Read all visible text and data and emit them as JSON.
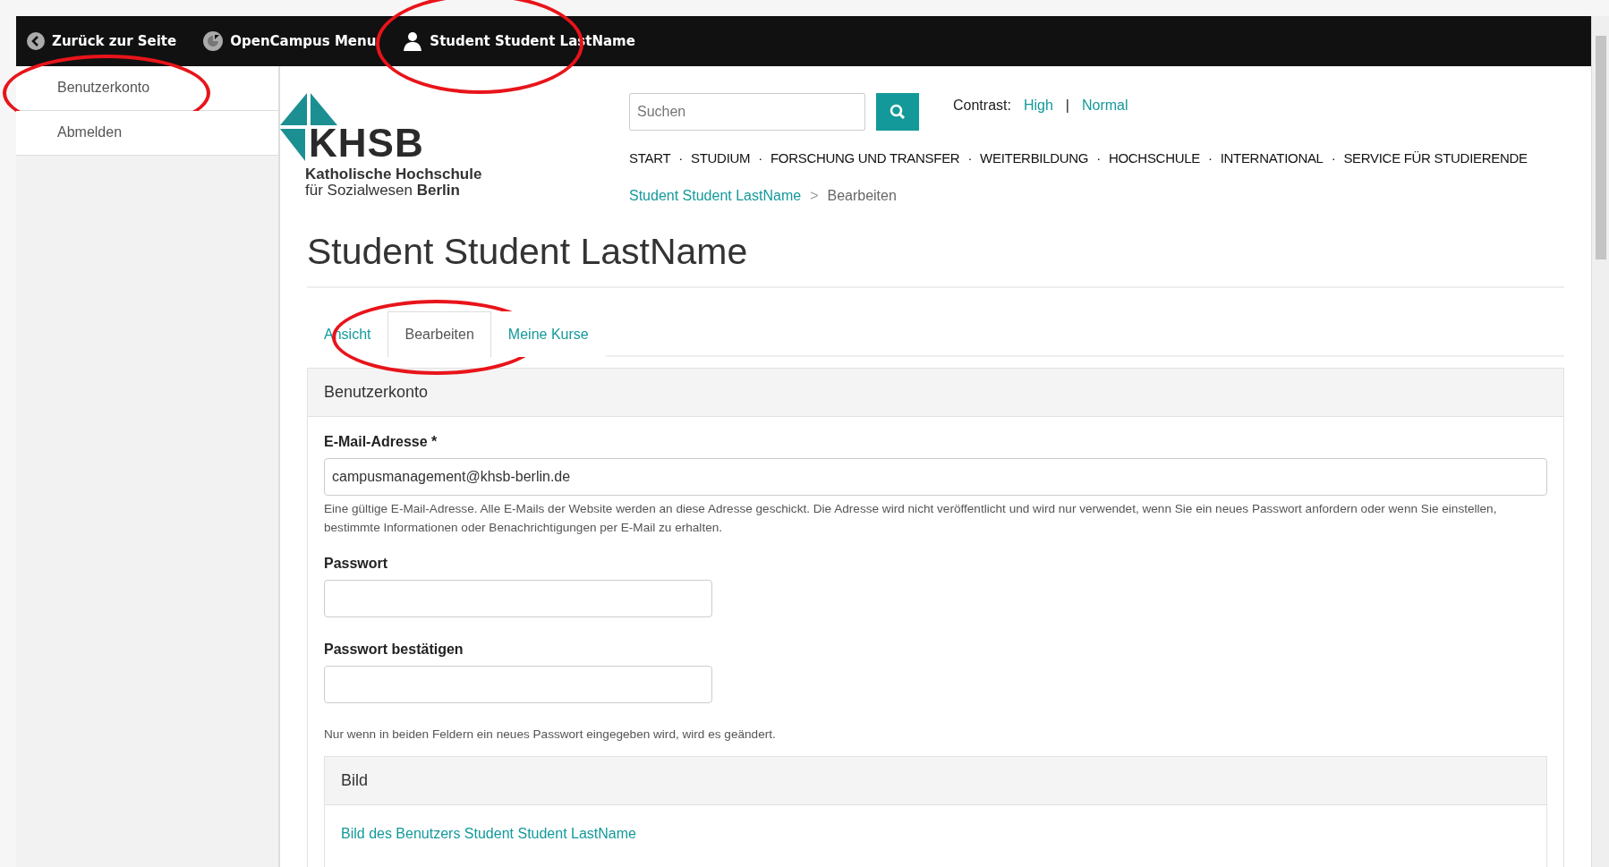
{
  "toolbar": {
    "items": [
      {
        "kind": "back",
        "label": "Zurück zur Seite",
        "highlighted": false
      },
      {
        "kind": "menu",
        "label": "OpenCampus Menu",
        "highlighted": false
      },
      {
        "kind": "user",
        "label": "Student Student LastName",
        "highlighted": true
      }
    ]
  },
  "sidebar": {
    "items": [
      {
        "label": "Benutzerkonto",
        "highlighted": true
      },
      {
        "label": "Abmelden",
        "highlighted": false
      }
    ]
  },
  "logo": {
    "wordmark": "KHSB",
    "line_1": "Katholische Hochschule",
    "line_2": "für Sozialwesen **Berlin**"
  },
  "search": {
    "placeholder": "Suchen"
  },
  "contrast": {
    "label": "Contrast:",
    "separator": "|",
    "options": [
      {
        "label": "High"
      },
      {
        "label": "Normal"
      }
    ]
  },
  "main_nav": {
    "separator": "·",
    "items": [
      "START",
      "STUDIUM",
      "FORSCHUNG UND TRANSFER",
      "WEITERBILDUNG",
      "HOCHSCHULE",
      "INTERNATIONAL",
      "SERVICE FÜR STUDIERENDE"
    ]
  },
  "breadcrumb": {
    "separator": ">",
    "items": [
      {
        "label": "Student Student LastName",
        "link": true
      },
      {
        "label": "Bearbeiten",
        "link": false
      }
    ]
  },
  "page_title": "Student Student LastName",
  "tabs": [
    {
      "label": "Ansicht",
      "selected": false,
      "highlighted": false
    },
    {
      "label": "Bearbeiten",
      "selected": true,
      "highlighted": true
    },
    {
      "label": "Meine Kurse",
      "selected": false,
      "highlighted": false
    }
  ],
  "account_panel": {
    "title": "Benutzerkonto",
    "fields": [
      {
        "kind": "email",
        "label": "E-Mail-Adresse *",
        "value": "campusmanagement@khsb-berlin.de",
        "description": "Eine gültige E-Mail-Adresse. Alle E-Mails der Website werden an diese Adresse geschickt. Die Adresse wird nicht veröffentlicht und wird nur verwendet, wenn Sie ein neues Passwort anfordern oder wenn Sie einstellen, bestimmte Informationen oder Benachrichtigungen per E-Mail zu erhalten."
      },
      {
        "kind": "password",
        "label": "Passwort"
      },
      {
        "kind": "password",
        "label": "Passwort bestätigen"
      }
    ],
    "note": "Nur wenn in beiden Feldern ein neues Passwort eingegeben wird, wird es geändert."
  },
  "picture_panel": {
    "title": "Bild",
    "link": "Bild des Benutzers Student Student LastName"
  }
}
